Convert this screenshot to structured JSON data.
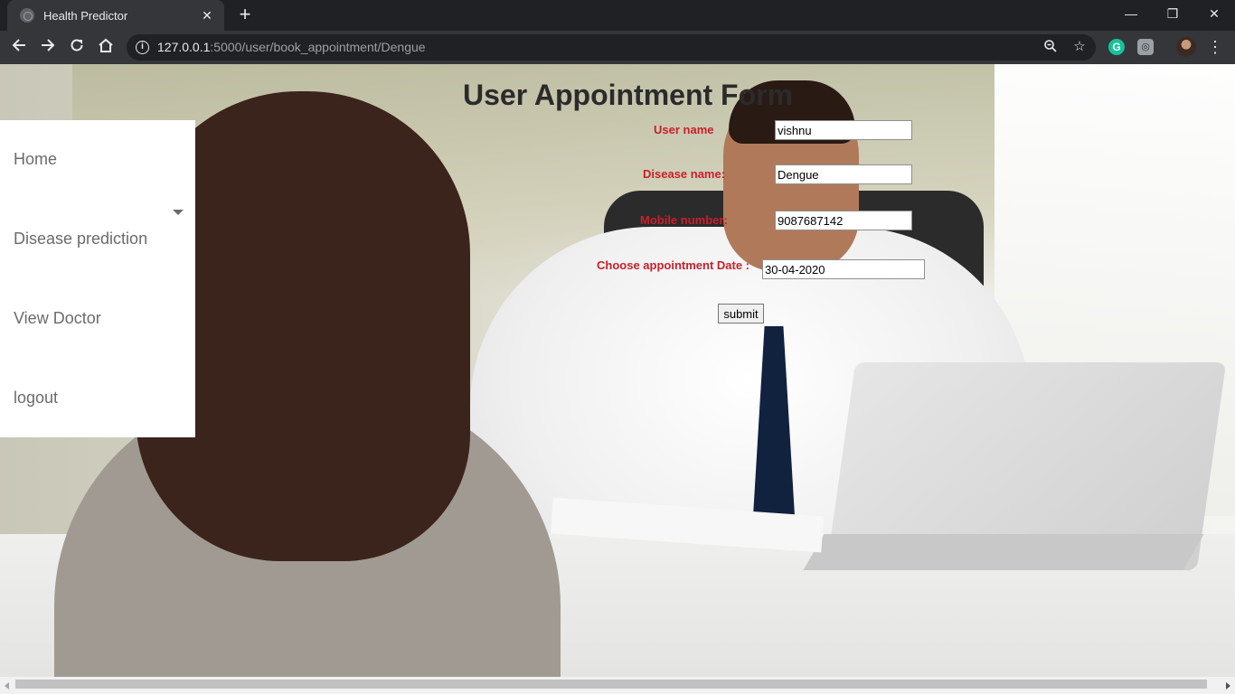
{
  "browser": {
    "tab_title": "Health Predictor",
    "tab_close": "✕",
    "new_tab": "+",
    "url_host": "127.0.0.1",
    "url_path": ":5000/user/book_appointment/Dengue",
    "window_controls": {
      "minimize": "—",
      "maximize": "❐",
      "close": "✕"
    },
    "extensions": {
      "grammarly": "G",
      "other": "◎"
    }
  },
  "page": {
    "title": "User Appointment Form"
  },
  "sidebar": {
    "items": [
      {
        "label": "Home"
      },
      {
        "label": "Disease prediction"
      },
      {
        "label": "View Doctor"
      },
      {
        "label": "logout"
      }
    ]
  },
  "form": {
    "user_name_label": "User name",
    "user_name_value": "vishnu",
    "disease_label": "Disease name:",
    "disease_value": "Dengue",
    "mobile_label": "Mobile number:",
    "mobile_value": "9087687142",
    "date_label": "Choose appointment Date :",
    "date_value": "30-04-2020",
    "submit_label": "submit"
  },
  "colors": {
    "label_red": "#c8202c",
    "sidebar_text": "#6b6b6b",
    "chrome_dark": "#202124",
    "chrome_toolbar": "#35363a"
  }
}
